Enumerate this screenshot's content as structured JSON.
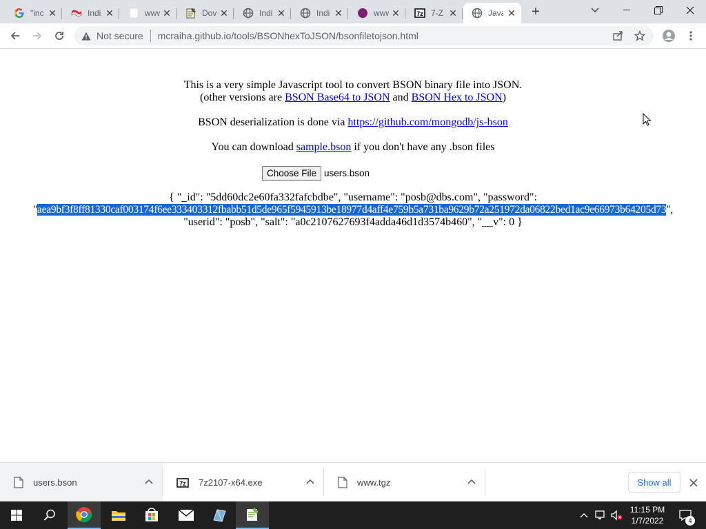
{
  "tabs": [
    {
      "title": "\"inc",
      "icon": "google-icon"
    },
    {
      "title": "Indi",
      "icon": "flag-icon"
    },
    {
      "title": "www",
      "icon": "blank-page-icon"
    },
    {
      "title": "Dov",
      "icon": "notepad-icon"
    },
    {
      "title": "Indi",
      "icon": "globe-icon"
    },
    {
      "title": "Indi",
      "icon": "globe-icon"
    },
    {
      "title": "www",
      "icon": "purple-circle-icon"
    },
    {
      "title": "7-Z",
      "icon": "7zip-icon"
    },
    {
      "title": "Java",
      "icon": "globe-icon",
      "active": true
    }
  ],
  "toolbar": {
    "security_label": "Not secure",
    "url": "mcraiha.github.io/tools/BSONhexToJSON/bsonfiletojson.html"
  },
  "page": {
    "intro_line1": "This is a very simple Javascript tool to convert BSON binary file into JSON.",
    "intro_line2_prefix": "(other versions are ",
    "link_base64": "BSON Base64 to JSON",
    "intro_line2_and": " and ",
    "link_hex": "BSON Hex to JSON",
    "intro_line2_suffix": ")",
    "deser_prefix": "BSON deserialization is done via ",
    "link_jsbson": "https://github.com/mongodb/js-bson",
    "download_prefix": "You can download ",
    "link_sample": "sample.bson",
    "download_suffix": " if you don't have any .bson files",
    "choose_file_label": "Choose File",
    "selected_file": "users.bson",
    "output_line1": "{ \"_id\": \"5dd60dc2e60fa332fafcbdbe\", \"username\": \"posb@dbs.com\", \"password\":",
    "output_line2_open": "\"",
    "output_hash": "aea9bf3f8ff81330caf003174f6ee333403312fbabb51d5de965f5945913be18977d4aff4e759b5a731ba9629b72a251972da06822bed1ac9e66973b64205d73",
    "output_line2_close": "\",",
    "output_line3": "\"userid\": \"posb\", \"salt\": \"a0c2107627693f4adda46d1d3574b460\", \"__v\": 0 }"
  },
  "downloads": {
    "items": [
      {
        "name": "users.bson",
        "icon": "file-icon"
      },
      {
        "name": "7z2107-x64.exe",
        "icon": "7zip-icon"
      },
      {
        "name": "www.tgz",
        "icon": "file-icon"
      }
    ],
    "show_all": "Show all"
  },
  "taskbar": {
    "time": "11:15 PM",
    "date": "1/7/2022",
    "notification_count": "4"
  },
  "colors": {
    "selection": "#1967d2",
    "link": "#0000ee",
    "tabbar": "#dee1e6",
    "taskbar": "#1f1f1f"
  }
}
